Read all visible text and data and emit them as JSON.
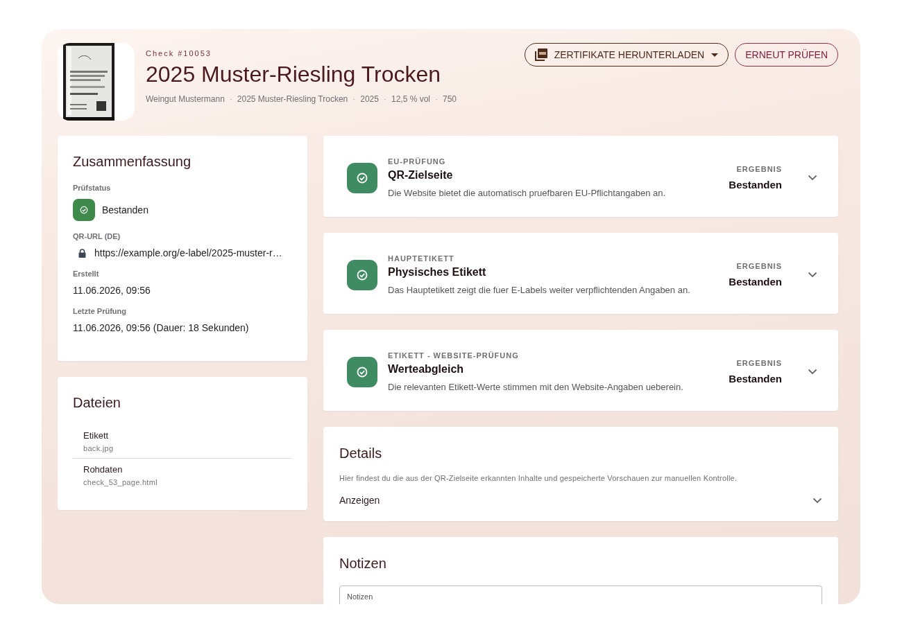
{
  "header": {
    "check_id": "Check #10053",
    "title": "2025 Muster-Riesling Trocken",
    "meta": [
      "Weingut Mustermann",
      "2025 Muster-Riesling Trocken",
      "2025",
      "12,5 % vol",
      "750"
    ],
    "meta_separator": "·",
    "actions": [
      {
        "kind": "dropdown",
        "label": "ZERTIFIKATE HERUNTERLADEN"
      },
      {
        "kind": "outline",
        "label": "ERNEUT PRÜFEN"
      }
    ]
  },
  "summary": {
    "title": "Zusammenfassung",
    "fields": [
      {
        "kind": "status",
        "label": "Prüfstatus",
        "value": "Bestanden",
        "passed": true
      },
      {
        "kind": "url",
        "label": "QR-URL (DE)",
        "value": "https://example.org/e-label/2025-muster-r…"
      },
      {
        "kind": "text",
        "label": "Erstellt",
        "value": "11.06.2026, 09:56"
      },
      {
        "kind": "text",
        "label": "Letzte Prüfung",
        "value": "11.06.2026, 09:56 (Dauer: 18 Sekunden)"
      }
    ]
  },
  "files": {
    "title": "Dateien",
    "items": [
      {
        "name": "Etikett",
        "file": "back.jpg"
      },
      {
        "name": "Rohdaten",
        "file": "check_53_page.html"
      }
    ]
  },
  "checks": [
    {
      "category": "EU-PRÜFUNG",
      "title": "QR-Zielseite",
      "description": "Die Website bietet die automatisch pruefbaren EU-Pflichtangaben an.",
      "result_label": "ERGEBNIS",
      "result": "Bestanden",
      "passed": true,
      "expanded": false
    },
    {
      "category": "HAUPTETIKETT",
      "title": "Physisches Etikett",
      "description": "Das Hauptetikett zeigt die fuer E-Labels weiter verpflichtenden Angaben an.",
      "result_label": "ERGEBNIS",
      "result": "Bestanden",
      "passed": true,
      "expanded": false
    },
    {
      "category": "ETIKETT - WEBSITE-PRÜFUNG",
      "title": "Werteabgleich",
      "description": "Die relevanten Etikett-Werte stimmen mit den Website-Angaben ueberein.",
      "result_label": "ERGEBNIS",
      "result": "Bestanden",
      "passed": true,
      "expanded": false
    }
  ],
  "details": {
    "title": "Details",
    "description": "Hier findest du die aus der QR-Zielseite erkannten Inhalte und gespeicherte Vorschauen zur manuellen Kontrolle.",
    "toggle": "Anzeigen",
    "expanded": false
  },
  "notes": {
    "title": "Notizen",
    "placeholder": "Notizen"
  }
}
